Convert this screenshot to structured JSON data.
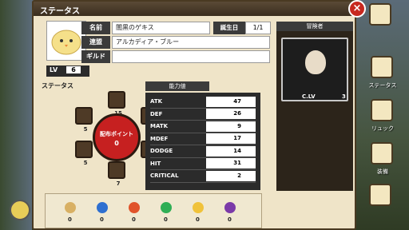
{
  "window": {
    "title": "ステータス"
  },
  "character": {
    "name_label": "名前",
    "name_value": "闇黒のゲキス",
    "affiliation_label": "連盟",
    "affiliation_value": "アルカディア・ブルー",
    "guild_label": "ギルド",
    "guild_value": "",
    "birthday_label": "誕生日",
    "birthday_value": "1/1",
    "level_label": "LV",
    "level_value": "6"
  },
  "adventurer": {
    "header": "冒険者",
    "clv_label": "C.LV",
    "clv_value": "3"
  },
  "status": {
    "label": "ステータス",
    "center_label": "配布ポイント",
    "center_value": "0",
    "nodes": [
      {
        "name": "attack",
        "value": "15"
      },
      {
        "name": "magic",
        "value": "5"
      },
      {
        "name": "agility",
        "value": "5"
      },
      {
        "name": "holy",
        "value": "5"
      },
      {
        "name": "water",
        "value": "7"
      },
      {
        "name": "defense",
        "value": "7"
      }
    ]
  },
  "ability": {
    "header": "能力値",
    "rows": [
      {
        "name": "ATK",
        "value": "47"
      },
      {
        "name": "DEF",
        "value": "26"
      },
      {
        "name": "MATK",
        "value": "9"
      },
      {
        "name": "MDEF",
        "value": "17"
      },
      {
        "name": "DODGE",
        "value": "14"
      },
      {
        "name": "HIT",
        "value": "31"
      },
      {
        "name": "CRITICAL",
        "value": "2"
      }
    ]
  },
  "elements": [
    {
      "icon": "earth-icon",
      "value": "0"
    },
    {
      "icon": "water-icon",
      "value": "0"
    },
    {
      "icon": "fire-icon",
      "value": "0"
    },
    {
      "icon": "wind-icon",
      "value": "0"
    },
    {
      "icon": "light-icon",
      "value": "0"
    },
    {
      "icon": "dark-icon",
      "value": "0"
    }
  ],
  "sidebar": {
    "items": [
      {
        "label": "ステータス"
      },
      {
        "label": "リュック"
      },
      {
        "label": "装備"
      }
    ]
  }
}
